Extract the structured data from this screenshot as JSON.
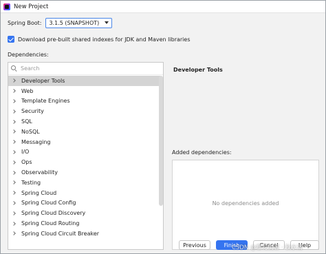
{
  "window": {
    "title": "New Project",
    "icon": "intellij-idea-icon"
  },
  "spring_boot": {
    "label": "Spring Boot:",
    "selected": "3.1.5 (SNAPSHOT)"
  },
  "download": {
    "checked": true,
    "label": "Download pre-built shared indexes for JDK and Maven libraries"
  },
  "dependencies": {
    "label": "Dependencies:",
    "search_placeholder": "Search",
    "items": [
      {
        "label": "Developer Tools",
        "selected": true
      },
      {
        "label": "Web"
      },
      {
        "label": "Template Engines"
      },
      {
        "label": "Security"
      },
      {
        "label": "SQL"
      },
      {
        "label": "NoSQL"
      },
      {
        "label": "Messaging"
      },
      {
        "label": "I/O"
      },
      {
        "label": "Ops"
      },
      {
        "label": "Observability"
      },
      {
        "label": "Testing"
      },
      {
        "label": "Spring Cloud"
      },
      {
        "label": "Spring Cloud Config"
      },
      {
        "label": "Spring Cloud Discovery"
      },
      {
        "label": "Spring Cloud Routing"
      },
      {
        "label": "Spring Cloud Circuit Breaker"
      }
    ]
  },
  "details": {
    "title": "Developer Tools"
  },
  "added": {
    "label": "Added dependencies:",
    "empty_text": "No dependencies added"
  },
  "buttons": {
    "previous": "Previous",
    "finish": "Finish",
    "cancel": "Cancel",
    "help": "Help"
  },
  "watermark": "CSDN @樱花剑客 · 秋水清",
  "colors": {
    "accent": "#3574f0",
    "selection": "#d4d4d4",
    "background": "#f2f2f2"
  }
}
